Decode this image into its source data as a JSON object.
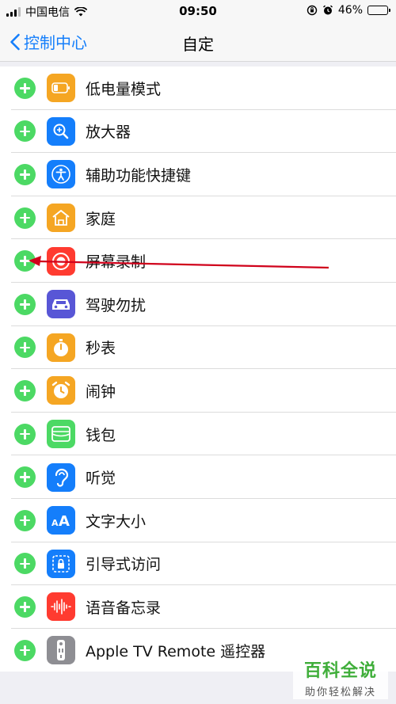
{
  "status_bar": {
    "carrier": "中国电信",
    "time": "09:50",
    "battery": "46%",
    "battery_level": 0.46
  },
  "nav": {
    "back_label": "控制中心",
    "title": "自定"
  },
  "items": [
    {
      "label": "低电量模式",
      "icon": "battery-icon",
      "color": "#f5a623"
    },
    {
      "label": "放大器",
      "icon": "magnifier-icon",
      "color": "#147efb"
    },
    {
      "label": "辅助功能快捷键",
      "icon": "accessibility-icon",
      "color": "#147efb"
    },
    {
      "label": "家庭",
      "icon": "home-icon",
      "color": "#f5a623"
    },
    {
      "label": "屏幕录制",
      "icon": "screen-record-icon",
      "color": "#ff3b30"
    },
    {
      "label": "驾驶勿扰",
      "icon": "car-icon",
      "color": "#5856d6"
    },
    {
      "label": "秒表",
      "icon": "stopwatch-icon",
      "color": "#f5a623"
    },
    {
      "label": "闹钟",
      "icon": "alarm-clock-icon",
      "color": "#f5a623"
    },
    {
      "label": "钱包",
      "icon": "wallet-icon",
      "color": "#4cd964"
    },
    {
      "label": "听觉",
      "icon": "ear-icon",
      "color": "#147efb"
    },
    {
      "label": "文字大小",
      "icon": "text-size-icon",
      "color": "#147efb"
    },
    {
      "label": "引导式访问",
      "icon": "guided-access-icon",
      "color": "#147efb"
    },
    {
      "label": "语音备忘录",
      "icon": "voice-memo-icon",
      "color": "#ff3b30"
    },
    {
      "label": "Apple TV Remote 遥控器",
      "icon": "tv-remote-icon",
      "color": "#8e8e93"
    }
  ],
  "watermark": {
    "main": "百科全说",
    "sub": "助你轻松解决"
  },
  "colors": {
    "accent": "#147efb",
    "add": "#4cd964",
    "annotation_arrow": "#d0021b"
  }
}
